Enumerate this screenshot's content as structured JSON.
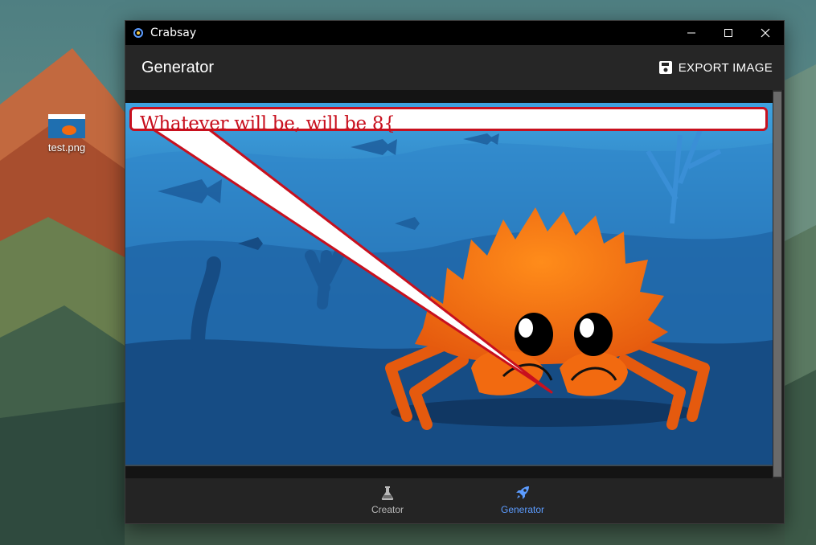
{
  "desktop": {
    "icon_label": "test.png"
  },
  "window": {
    "title": "Crabsay",
    "appbar_title": "Generator",
    "export_label": "EXPORT IMAGE"
  },
  "speech_bubble": {
    "text": "Whatever will be, will be 8{"
  },
  "bottom_nav": {
    "items": [
      {
        "label": "Creator",
        "icon": "flask-icon",
        "active": false
      },
      {
        "label": "Generator",
        "icon": "rocket-icon",
        "active": true
      }
    ]
  },
  "colors": {
    "active_nav": "#5c9cff",
    "bubble_border": "#c8101e",
    "crab": "#f26a10"
  }
}
